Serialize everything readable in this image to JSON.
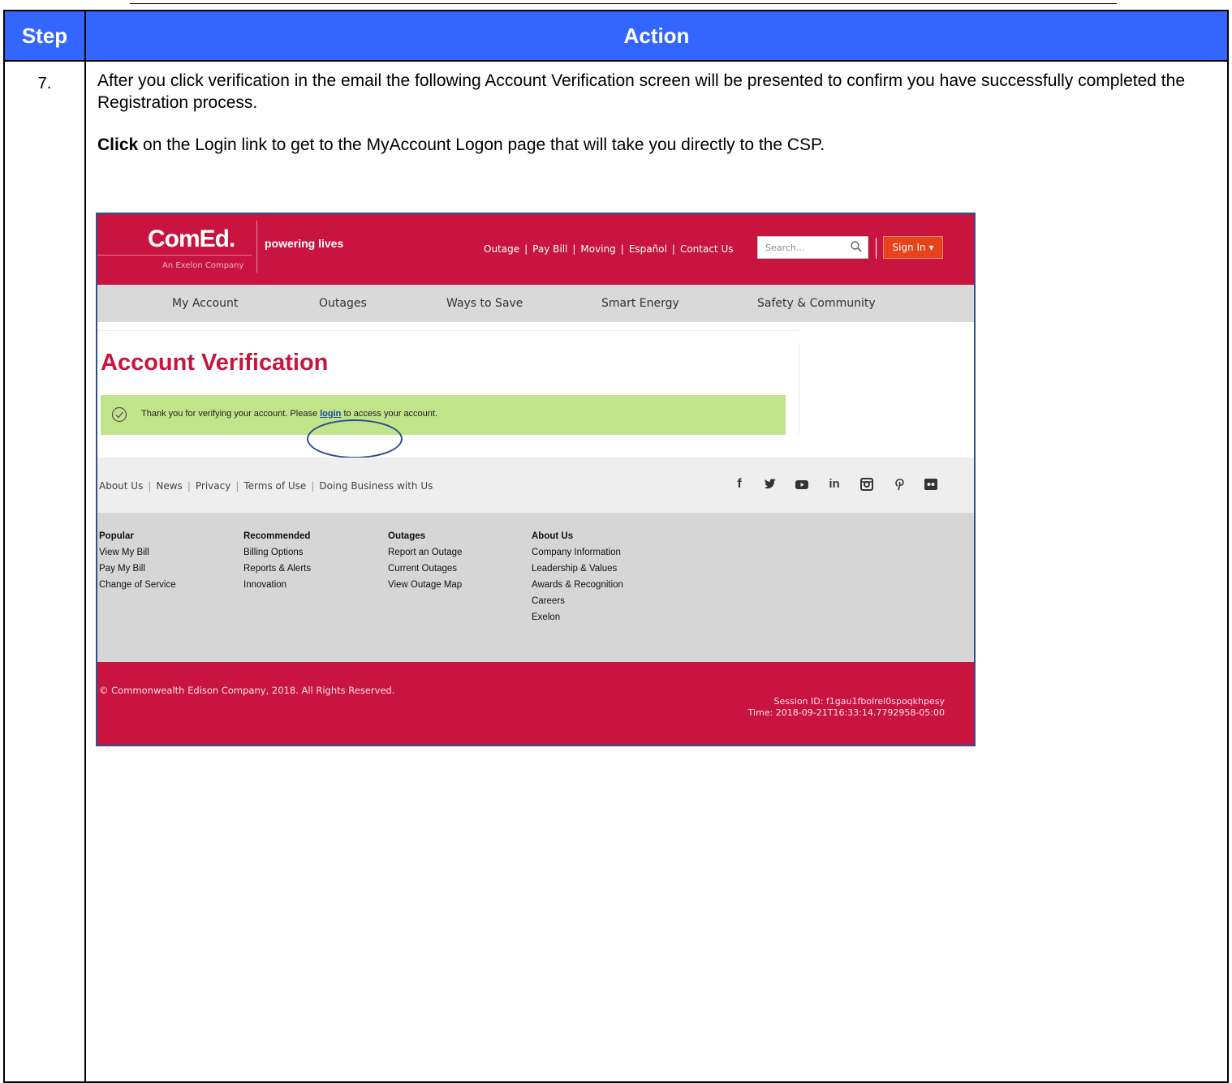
{
  "table": {
    "header_step": "Step",
    "header_action": "Action",
    "step_number": "7.",
    "para1": "After you click verification in the email the following Account Verification screen will be presented to confirm you have successfully completed the Registration process.",
    "para2_bold": "Click",
    "para2_rest": " on the Login link to get to the MyAccount Logon page that will take you directly to the CSP."
  },
  "screenshot": {
    "logo": "ComEd.",
    "logo_sub": "An Exelon Company",
    "tagline": "powering lives",
    "top_links": [
      "Outage",
      "Pay Bill",
      "Moving",
      "Español",
      "Contact Us"
    ],
    "search_placeholder": "Search...",
    "sign_in": "Sign In ▾",
    "nav": [
      "My Account",
      "Outages",
      "Ways to Save",
      "Smart Energy",
      "Safety & Community"
    ],
    "page_title": "Account Verification",
    "banner_pre": "Thank you for verifying your account. Please ",
    "banner_link": "login",
    "banner_post": " to access your account.",
    "footer_links": [
      "About Us",
      "News",
      "Privacy",
      "Terms of Use",
      "Doing Business with Us"
    ],
    "social_icons": [
      "facebook-icon",
      "twitter-icon",
      "youtube-icon",
      "linkedin-icon",
      "instagram-icon",
      "pinterest-icon",
      "flickr-icon"
    ],
    "columns": [
      {
        "heading": "Popular",
        "items": [
          "View My Bill",
          "Pay My Bill",
          "Change of Service"
        ]
      },
      {
        "heading": "Recommended",
        "items": [
          "Billing Options",
          "Reports & Alerts",
          "Innovation"
        ]
      },
      {
        "heading": "Outages",
        "items": [
          "Report an Outage",
          "Current Outages",
          "View Outage Map"
        ]
      },
      {
        "heading": "About Us",
        "items": [
          "Company Information",
          "Leadership & Values",
          "Awards & Recognition",
          "Careers",
          "Exelon"
        ]
      }
    ],
    "copyright": "© Commonwealth Edison Company, 2018. All Rights Reserved.",
    "session_id": "Session ID: f1gau1fbolrel0spoqkhpesy",
    "time": "Time: 2018-09-21T16:33:14.7792958-05:00",
    "colors": {
      "brand": "#c8143f",
      "header_blue": "#3366ff",
      "banner_green": "#c0e48a",
      "sign_in": "#e8421b"
    }
  }
}
